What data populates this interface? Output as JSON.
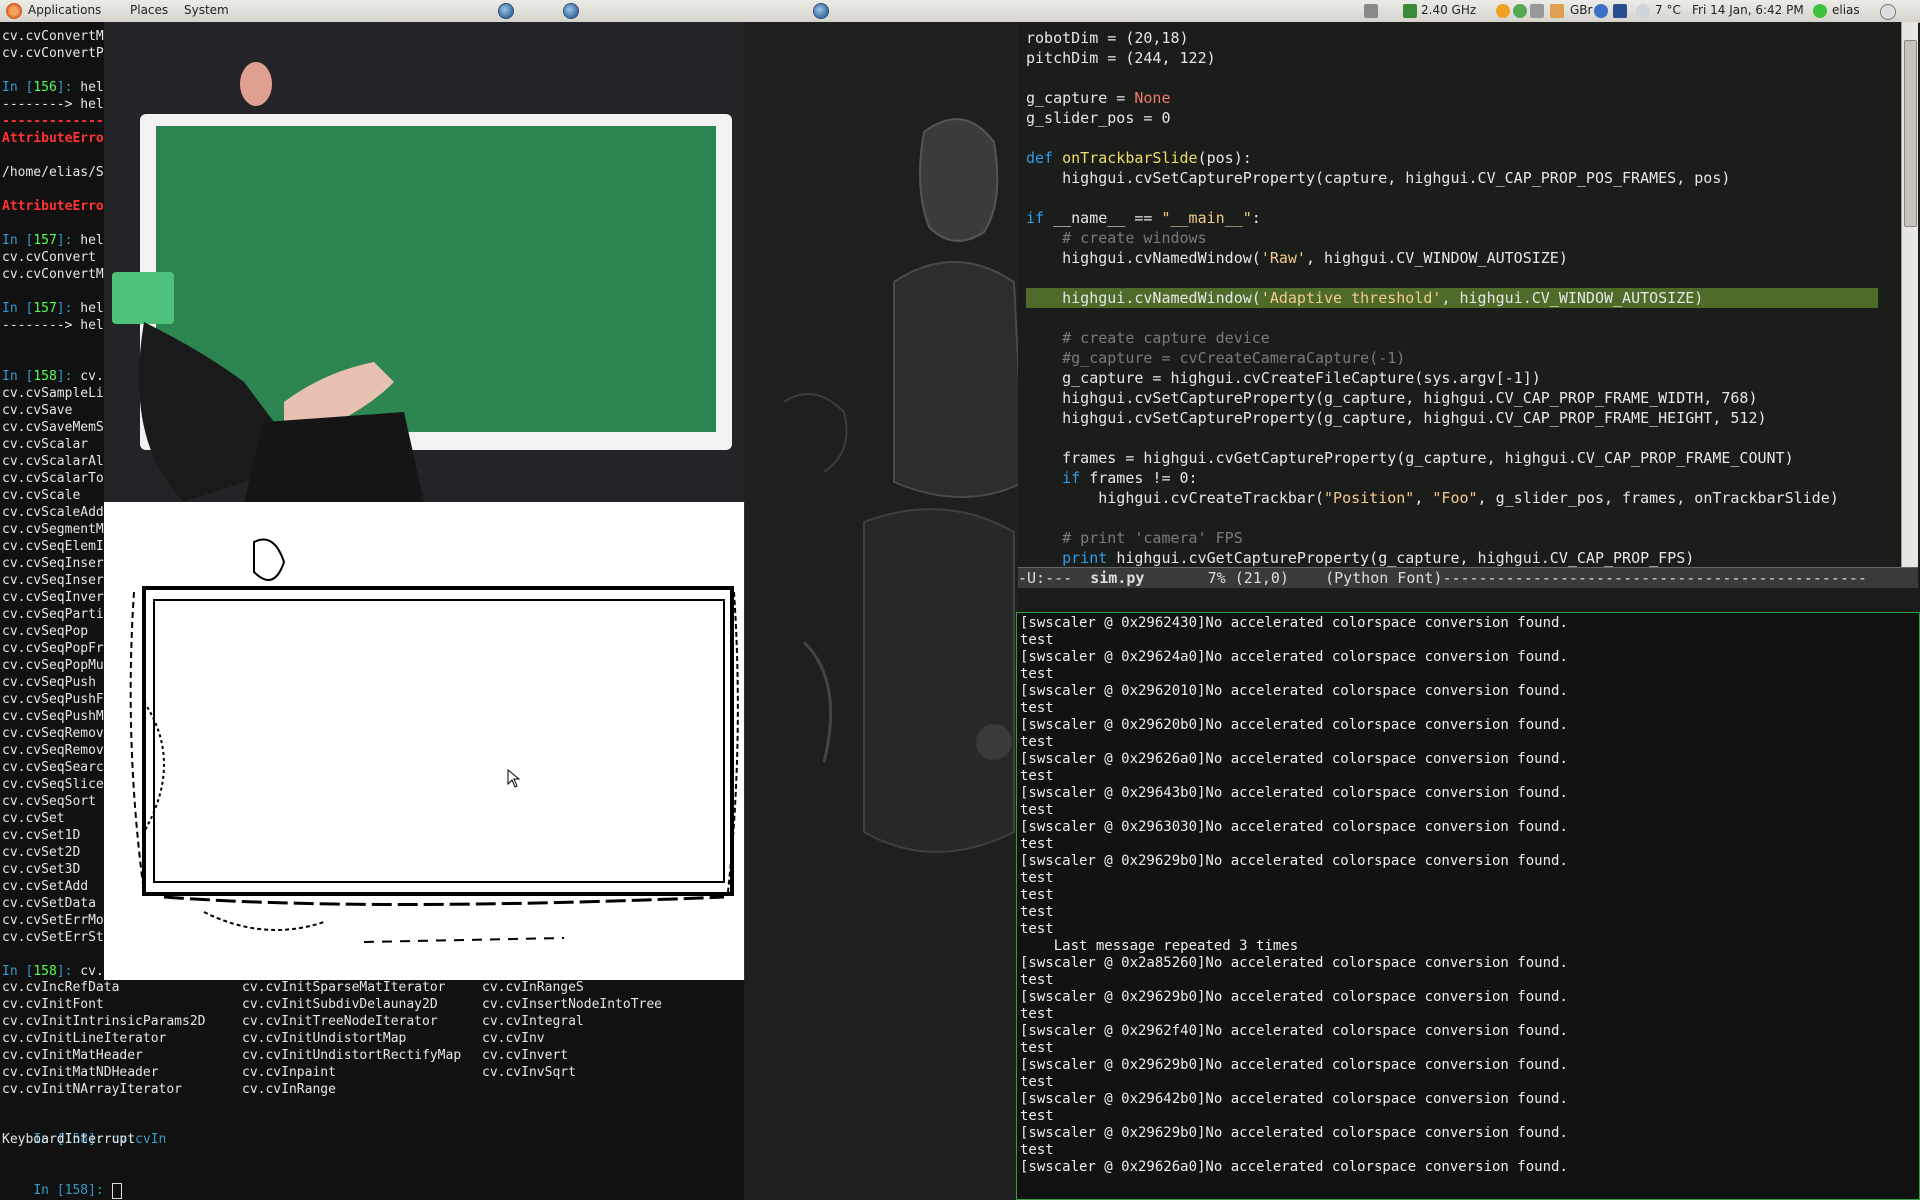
{
  "topbar": {
    "menus": [
      "Applications",
      "Places",
      "System"
    ],
    "cpu": "2.40 GHz",
    "keyboard": "GBr",
    "weather": "7 °C",
    "datetime": "Fri 14 Jan,  6:42 PM",
    "user": "elias"
  },
  "ipython": {
    "lines_top": [
      {
        "t": "cv.cvConvertM"
      },
      {
        "t": "cv.cvConvertP"
      },
      {
        "t": ""
      },
      {
        "t": "In [156]: hel",
        "p": true
      },
      {
        "t": "--------> hel"
      },
      {
        "t": "---------------",
        "e": true
      },
      {
        "t": "AttributeErro",
        "e": true
      },
      {
        "t": ""
      },
      {
        "t": "/home/elias/S"
      },
      {
        "t": ""
      },
      {
        "t": "AttributeErro",
        "e": true
      },
      {
        "t": ""
      },
      {
        "t": "In [157]: hel",
        "p": true
      },
      {
        "t": "cv.cvConvert"
      },
      {
        "t": "cv.cvConvertM"
      },
      {
        "t": ""
      },
      {
        "t": "In [157]: hel",
        "p": true
      },
      {
        "t": "--------> hel"
      },
      {
        "t": ""
      },
      {
        "t": ""
      },
      {
        "t": "In [158]: cv.",
        "p": true
      },
      {
        "t": "cv.cvSampleLi"
      },
      {
        "t": "cv.cvSave"
      },
      {
        "t": "cv.cvSaveMemS"
      },
      {
        "t": "cv.cvScalar"
      },
      {
        "t": "cv.cvScalarAl"
      },
      {
        "t": "cv.cvScalarTo"
      },
      {
        "t": "cv.cvScale"
      },
      {
        "t": "cv.cvScaleAdd"
      },
      {
        "t": "cv.cvSegmentM"
      },
      {
        "t": "cv.cvSeqElemI"
      },
      {
        "t": "cv.cvSeqInser"
      },
      {
        "t": "cv.cvSeqInser"
      },
      {
        "t": "cv.cvSeqInver"
      },
      {
        "t": "cv.cvSeqParti"
      },
      {
        "t": "cv.cvSeqPop"
      },
      {
        "t": "cv.cvSeqPopFr"
      },
      {
        "t": "cv.cvSeqPopMu"
      },
      {
        "t": "cv.cvSeqPush"
      },
      {
        "t": "cv.cvSeqPushF"
      },
      {
        "t": "cv.cvSeqPushM"
      },
      {
        "t": "cv.cvSeqRemov"
      },
      {
        "t": "cv.cvSeqRemov"
      },
      {
        "t": "cv.cvSeqSearc"
      },
      {
        "t": "cv.cvSeqSlice"
      },
      {
        "t": "cv.cvSeqSort"
      },
      {
        "t": "cv.cvSet"
      },
      {
        "t": "cv.cvSet1D"
      },
      {
        "t": "cv.cvSet2D"
      },
      {
        "t": "cv.cvSet3D"
      },
      {
        "t": "cv.cvSetAdd"
      },
      {
        "t": "cv.cvSetData"
      },
      {
        "t": "cv.cvSetErrMo"
      },
      {
        "t": "cv.cvSetErrSt"
      },
      {
        "t": ""
      },
      {
        "t": "In [158]: cv.",
        "p": true
      }
    ],
    "col1": [
      "cv.cvIncRefData",
      "cv.cvInitFont",
      "cv.cvInitIntrinsicParams2D",
      "cv.cvInitLineIterator",
      "cv.cvInitMatHeader",
      "cv.cvInitMatNDHeader",
      "cv.cvInitNArrayIterator"
    ],
    "col2": [
      "cv.cvInitSparseMatIterator",
      "cv.cvInitSubdivDelaunay2D",
      "cv.cvInitTreeNodeIterator",
      "cv.cvInitUndistortMap",
      "cv.cvInitUndistortRectifyMap",
      "cv.cvInpaint",
      "cv.cvInRange"
    ],
    "col3": [
      "cv.cvInRangeS",
      "cv.cvInsertNodeIntoTree",
      "cv.cvIntegral",
      "cv.cvInv",
      "cv.cvInvert",
      "cv.cvInvSqrt"
    ],
    "tail_prompt": "In [158]: cv.cvIn",
    "interrupt": "KeyboardInterrupt",
    "final_prompt": "In [158]: "
  },
  "emacs": {
    "filename": "sim.py",
    "modeline_prefix": "-U:---  ",
    "modeline_pos": "7% (21,0)",
    "modeline_mode": "(Python Font)",
    "highlight_line": 13,
    "code": [
      [
        [
          "t",
          "robotDim = (20,18)"
        ]
      ],
      [
        [
          "t",
          "pitchDim = (244, 122)"
        ]
      ],
      [],
      [
        [
          "t",
          "g_capture = "
        ],
        [
          "c",
          "None"
        ]
      ],
      [
        [
          "t",
          "g_slider_pos = 0"
        ]
      ],
      [],
      [
        [
          "k",
          "def "
        ],
        [
          "f",
          "onTrackbarSlide"
        ],
        [
          "t",
          "(pos):"
        ]
      ],
      [
        [
          "t",
          "    highgui.cvSetCaptureProperty(capture, highgui.CV_CAP_PROP_POS_FRAMES, pos)"
        ]
      ],
      [],
      [
        [
          "k",
          "if "
        ],
        [
          "t",
          "__name__ == "
        ],
        [
          "s",
          "\"__main__\""
        ],
        [
          "t",
          ":"
        ]
      ],
      [
        [
          "m",
          "    # create windows"
        ]
      ],
      [
        [
          "t",
          "    highgui.cvNamedWindow("
        ],
        [
          "s",
          "'Raw'"
        ],
        [
          "t",
          ", highgui.CV_WINDOW_AUTOSIZE)"
        ]
      ],
      [],
      [
        [
          "t",
          "    highgui.cvNamedWindow("
        ],
        [
          "s",
          "'Adaptive threshold'"
        ],
        [
          "t",
          ", highgui.CV_WINDOW_AUTOSIZE)"
        ]
      ],
      [],
      [
        [
          "m",
          "    # create capture device"
        ]
      ],
      [
        [
          "m",
          "    #g_capture = cvCreateCameraCapture(-1)"
        ]
      ],
      [
        [
          "t",
          "    g_capture = highgui.cvCreateFileCapture(sys.argv[-1])"
        ]
      ],
      [
        [
          "t",
          "    highgui.cvSetCaptureProperty(g_capture, highgui.CV_CAP_PROP_FRAME_WIDTH, 768)"
        ]
      ],
      [
        [
          "t",
          "    highgui.cvSetCaptureProperty(g_capture, highgui.CV_CAP_PROP_FRAME_HEIGHT, 512)"
        ]
      ],
      [],
      [
        [
          "t",
          "    frames = highgui.cvGetCaptureProperty(g_capture, highgui.CV_CAP_PROP_FRAME_COUNT)"
        ]
      ],
      [
        [
          "t",
          "    "
        ],
        [
          "k",
          "if "
        ],
        [
          "t",
          "frames != 0:"
        ]
      ],
      [
        [
          "t",
          "        highgui.cvCreateTrackbar("
        ],
        [
          "s",
          "\"Position\""
        ],
        [
          "t",
          ", "
        ],
        [
          "s",
          "\"Foo\""
        ],
        [
          "t",
          ", g_slider_pos, frames, onTrackbarSlide)"
        ]
      ],
      [],
      [
        [
          "m",
          "    # print 'camera' FPS"
        ]
      ],
      [
        [
          "t",
          "    "
        ],
        [
          "k",
          "print "
        ],
        [
          "t",
          "highgui.cvGetCaptureProperty(g_capture, highgui.CV_CAP_PROP_FPS)"
        ]
      ]
    ]
  },
  "output": {
    "lines": [
      "[swscaler @ 0x2962430]No accelerated colorspace conversion found.",
      "test",
      "[swscaler @ 0x29624a0]No accelerated colorspace conversion found.",
      "test",
      "[swscaler @ 0x2962010]No accelerated colorspace conversion found.",
      "test",
      "[swscaler @ 0x29620b0]No accelerated colorspace conversion found.",
      "test",
      "[swscaler @ 0x29626a0]No accelerated colorspace conversion found.",
      "test",
      "[swscaler @ 0x29643b0]No accelerated colorspace conversion found.",
      "test",
      "[swscaler @ 0x2963030]No accelerated colorspace conversion found.",
      "test",
      "[swscaler @ 0x29629b0]No accelerated colorspace conversion found.",
      "test",
      "test",
      "test",
      "test",
      "    Last message repeated 3 times",
      "[swscaler @ 0x2a85260]No accelerated colorspace conversion found.",
      "test",
      "[swscaler @ 0x29629b0]No accelerated colorspace conversion found.",
      "test",
      "[swscaler @ 0x2962f40]No accelerated colorspace conversion found.",
      "test",
      "[swscaler @ 0x29629b0]No accelerated colorspace conversion found.",
      "test",
      "[swscaler @ 0x29642b0]No accelerated colorspace conversion found.",
      "test",
      "[swscaler @ 0x29629b0]No accelerated colorspace conversion found.",
      "test",
      "[swscaler @ 0x29626a0]No accelerated colorspace conversion found."
    ]
  },
  "colors": {
    "keyword": "#2f9ce8",
    "function": "#eedd66",
    "string": "#f4c98c",
    "constant": "#f07a6c",
    "comment": "#7a7a7a",
    "highlight": "#4f6b2a",
    "terminal_border": "#2ea04a"
  }
}
